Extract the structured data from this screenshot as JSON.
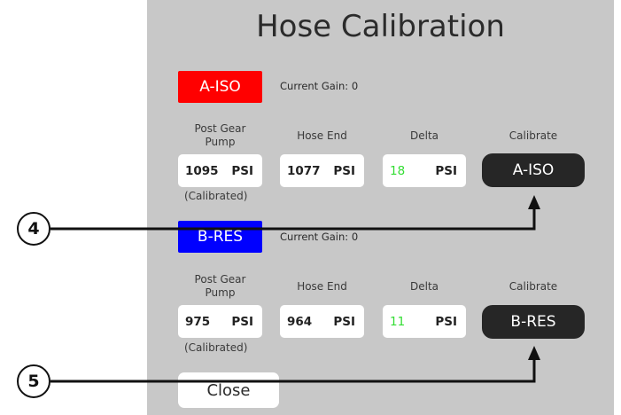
{
  "title": "Hose Calibration",
  "channels": [
    {
      "label": "A-ISO",
      "color": "#ff0000",
      "gain_label": "Current Gain:",
      "gain_value": "0",
      "headers": {
        "post_gear": "Post Gear Pump",
        "hose_end": "Hose End",
        "delta": "Delta",
        "calibrate": "Calibrate"
      },
      "post_gear_value": "1095",
      "hose_end_value": "1077",
      "delta_value": "18",
      "unit": "PSI",
      "calibrated_note": "(Calibrated)",
      "calibrate_button": "A-ISO"
    },
    {
      "label": "B-RES",
      "color": "#0000ff",
      "gain_label": "Current Gain:",
      "gain_value": "0",
      "headers": {
        "post_gear": "Post Gear Pump",
        "hose_end": "Hose End",
        "delta": "Delta",
        "calibrate": "Calibrate"
      },
      "post_gear_value": "975",
      "hose_end_value": "964",
      "delta_value": "11",
      "unit": "PSI",
      "calibrated_note": "(Calibrated)",
      "calibrate_button": "B-RES"
    }
  ],
  "close_button": "Close",
  "callouts": [
    "4",
    "5"
  ],
  "colors": {
    "panel": "#c8c8c8",
    "button_dark": "#262626",
    "delta_green": "#33dd33"
  }
}
